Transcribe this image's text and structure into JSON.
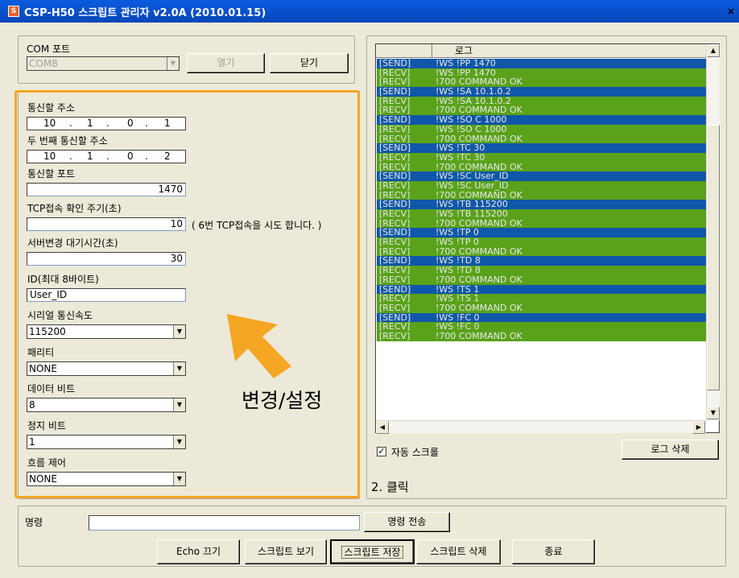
{
  "window": {
    "title": "CSP-H50 스크립트 관리자 v2.0A (2010.01.15)",
    "close_glyph": "×"
  },
  "com": {
    "group_label": "COM 포트",
    "port_value": "COM8",
    "open_label": "열기",
    "close_label": "닫기"
  },
  "settings": {
    "address_label": "통신할 주소",
    "address": [
      "10",
      "1",
      "0",
      "1"
    ],
    "address2_label": "두 번째 통신할 주소",
    "address2": [
      "10",
      "1",
      "0",
      "2"
    ],
    "port_label": "통신할 포트",
    "port_value": "1470",
    "tcp_label": "TCP접속 확인 주기(초)",
    "tcp_value": "10",
    "tcp_note": "( 6번 TCP접속을 시도 합니다. )",
    "wait_label": "서버변경 대기시간(초)",
    "wait_value": "30",
    "id_label": "ID(최대 8바이트)",
    "id_value": "User_ID",
    "baud_label": "시리얼 통신속도",
    "baud_value": "115200",
    "parity_label": "패리티",
    "parity_value": "NONE",
    "databits_label": "데이터 비트",
    "databits_value": "8",
    "stopbits_label": "정지 비트",
    "stopbits_value": "1",
    "flow_label": "흐름 제어",
    "flow_value": "NONE"
  },
  "annotation": {
    "change_label": "변경/설정",
    "click_label": "2. 클릭"
  },
  "log": {
    "column_header": "로그",
    "rows": [
      {
        "dir": "[SEND]",
        "msg": "!WS !PP 1470",
        "type": "send"
      },
      {
        "dir": "[RECV]",
        "msg": "!WS !PP 1470",
        "type": "recv"
      },
      {
        "dir": "[RECV]",
        "msg": "!700 COMMAND OK",
        "type": "recv"
      },
      {
        "dir": "[SEND]",
        "msg": "!WS !SA 10.1.0.2",
        "type": "send"
      },
      {
        "dir": "[RECV]",
        "msg": "!WS !SA 10.1.0.2",
        "type": "recv"
      },
      {
        "dir": "[RECV]",
        "msg": "!700 COMMAND OK",
        "type": "recv"
      },
      {
        "dir": "[SEND]",
        "msg": "!WS !SO C 1000",
        "type": "send"
      },
      {
        "dir": "[RECV]",
        "msg": "!WS !SO C 1000",
        "type": "recv"
      },
      {
        "dir": "[RECV]",
        "msg": "!700 COMMAND OK",
        "type": "recv"
      },
      {
        "dir": "[SEND]",
        "msg": "!WS !TC 30",
        "type": "send"
      },
      {
        "dir": "[RECV]",
        "msg": "!WS !TC 30",
        "type": "recv"
      },
      {
        "dir": "[RECV]",
        "msg": "!700 COMMAND OK",
        "type": "recv"
      },
      {
        "dir": "[SEND]",
        "msg": "!WS !SC User_ID",
        "type": "send"
      },
      {
        "dir": "[RECV]",
        "msg": "!WS !SC User_ID",
        "type": "recv"
      },
      {
        "dir": "[RECV]",
        "msg": "!700 COMMAND OK",
        "type": "recv"
      },
      {
        "dir": "[SEND]",
        "msg": "!WS !TB 115200",
        "type": "send"
      },
      {
        "dir": "[RECV]",
        "msg": "!WS !TB 115200",
        "type": "recv"
      },
      {
        "dir": "[RECV]",
        "msg": "!700 COMMAND OK",
        "type": "recv"
      },
      {
        "dir": "[SEND]",
        "msg": "!WS !TP 0",
        "type": "send"
      },
      {
        "dir": "[RECV]",
        "msg": "!WS !TP 0",
        "type": "recv"
      },
      {
        "dir": "[RECV]",
        "msg": "!700 COMMAND OK",
        "type": "recv"
      },
      {
        "dir": "[SEND]",
        "msg": "!WS !TD 8",
        "type": "send"
      },
      {
        "dir": "[RECV]",
        "msg": "!WS !TD 8",
        "type": "recv"
      },
      {
        "dir": "[RECV]",
        "msg": "!700 COMMAND OK",
        "type": "recv"
      },
      {
        "dir": "[SEND]",
        "msg": "!WS !TS 1",
        "type": "send"
      },
      {
        "dir": "[RECV]",
        "msg": "!WS !TS 1",
        "type": "recv"
      },
      {
        "dir": "[RECV]",
        "msg": "!700 COMMAND OK",
        "type": "recv"
      },
      {
        "dir": "[SEND]",
        "msg": "!WS !FC 0",
        "type": "send"
      },
      {
        "dir": "[RECV]",
        "msg": "!WS !FC 0",
        "type": "recv"
      },
      {
        "dir": "[RECV]",
        "msg": "!700 COMMAND OK",
        "type": "recv"
      }
    ],
    "auto_scroll_label": "자동 스크롤",
    "auto_scroll_checked": true,
    "clear_label": "로그 삭제"
  },
  "command": {
    "label": "명령",
    "value": "",
    "send_label": "명령 전송"
  },
  "bottom_buttons": {
    "echo_off": "Echo 끄기",
    "view_script": "스크립트 보기",
    "save_script": "스크립트 저장",
    "delete_script": "스크립트 삭제",
    "exit": "종료"
  },
  "colors": {
    "send_row": "#0f57a8",
    "recv_row": "#5aa21a",
    "highlight": "#f5a623"
  }
}
